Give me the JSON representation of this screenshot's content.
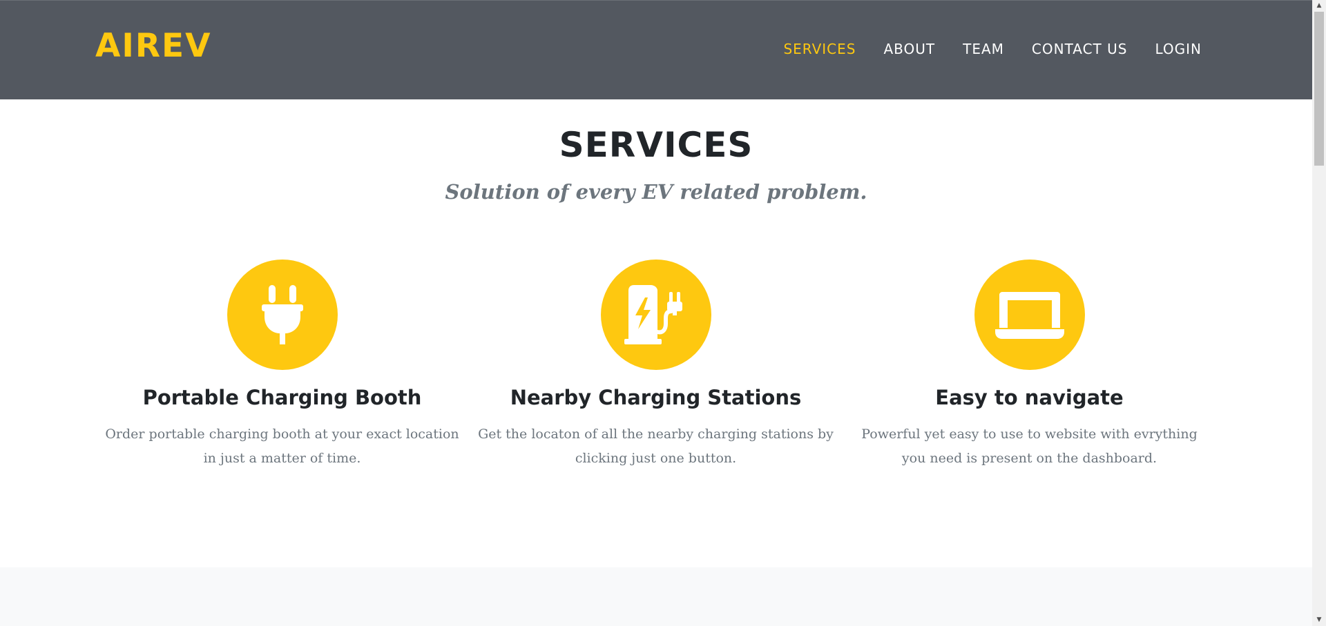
{
  "header": {
    "brand": "AIREV",
    "nav": [
      {
        "label": "SERVICES",
        "active": true
      },
      {
        "label": "ABOUT",
        "active": false
      },
      {
        "label": "TEAM",
        "active": false
      },
      {
        "label": "CONTACT US",
        "active": false
      },
      {
        "label": "LOGIN",
        "active": false
      }
    ]
  },
  "services": {
    "title": "SERVICES",
    "subtitle": "Solution of every EV related problem.",
    "items": [
      {
        "icon": "plug-icon",
        "title": "Portable Charging Booth",
        "text": "Order portable charging booth at your exact location in just a matter of time."
      },
      {
        "icon": "charging-station-icon",
        "title": "Nearby Charging Stations",
        "text": "Get the locaton of all the nearby charging stations by clicking just one button."
      },
      {
        "icon": "laptop-icon",
        "title": "Easy to navigate",
        "text": "Powerful yet easy to use to website with evrything you need is present on the dashboard."
      }
    ]
  },
  "colors": {
    "accent": "#fec810",
    "header_bg": "#535860",
    "heading": "#212529",
    "muted": "#6c757d"
  }
}
